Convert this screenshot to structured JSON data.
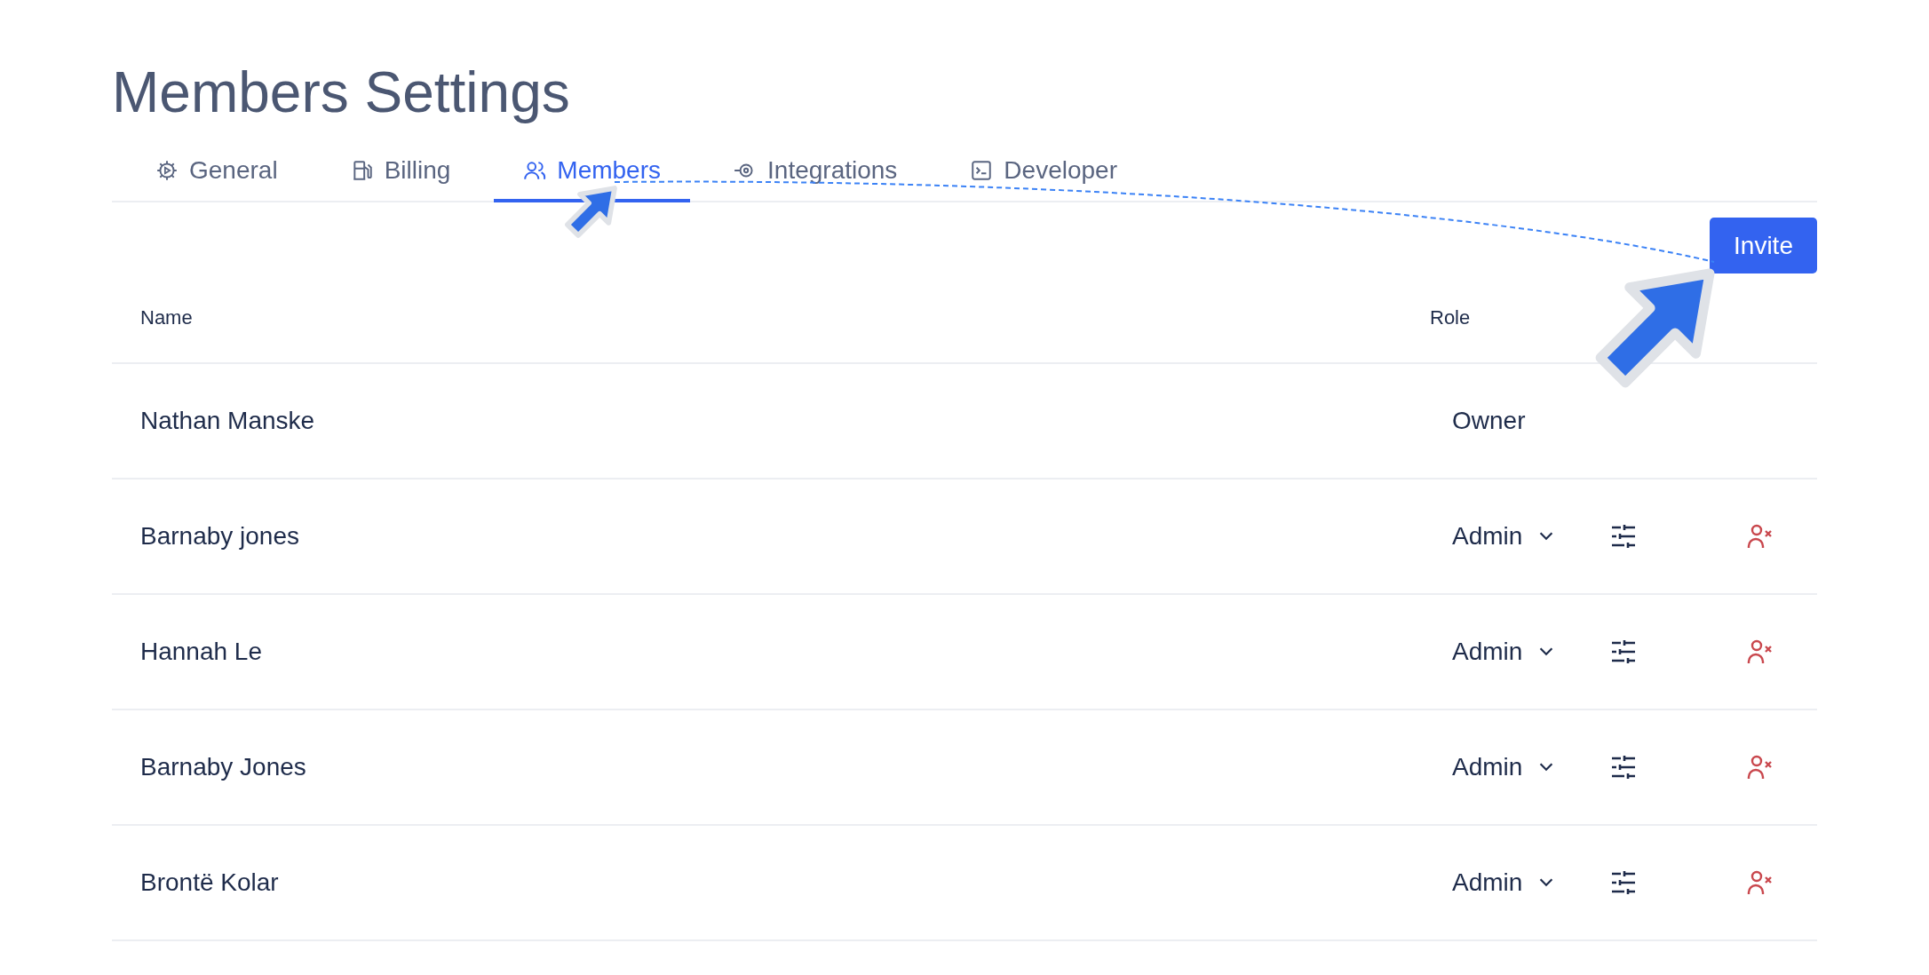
{
  "page": {
    "title": "Members Settings"
  },
  "tabs": [
    {
      "label": "General",
      "selected": false
    },
    {
      "label": "Billing",
      "selected": false
    },
    {
      "label": "Members",
      "selected": true
    },
    {
      "label": "Integrations",
      "selected": false
    },
    {
      "label": "Developer",
      "selected": false
    }
  ],
  "invite_button": {
    "label": "Invite"
  },
  "table": {
    "columns": [
      "Name",
      "Role"
    ],
    "rows": [
      {
        "name": "Nathan Manske",
        "role": "Owner",
        "kind": "fixed"
      },
      {
        "name": "Barnaby jones",
        "role": "Admin",
        "kind": "editable"
      },
      {
        "name": "Hannah Le",
        "role": "Admin",
        "kind": "editable"
      },
      {
        "name": "Barnaby Jones",
        "role": "Admin",
        "kind": "editable"
      },
      {
        "name": "Brontë Kolar",
        "role": "Admin",
        "kind": "editable"
      }
    ]
  }
}
